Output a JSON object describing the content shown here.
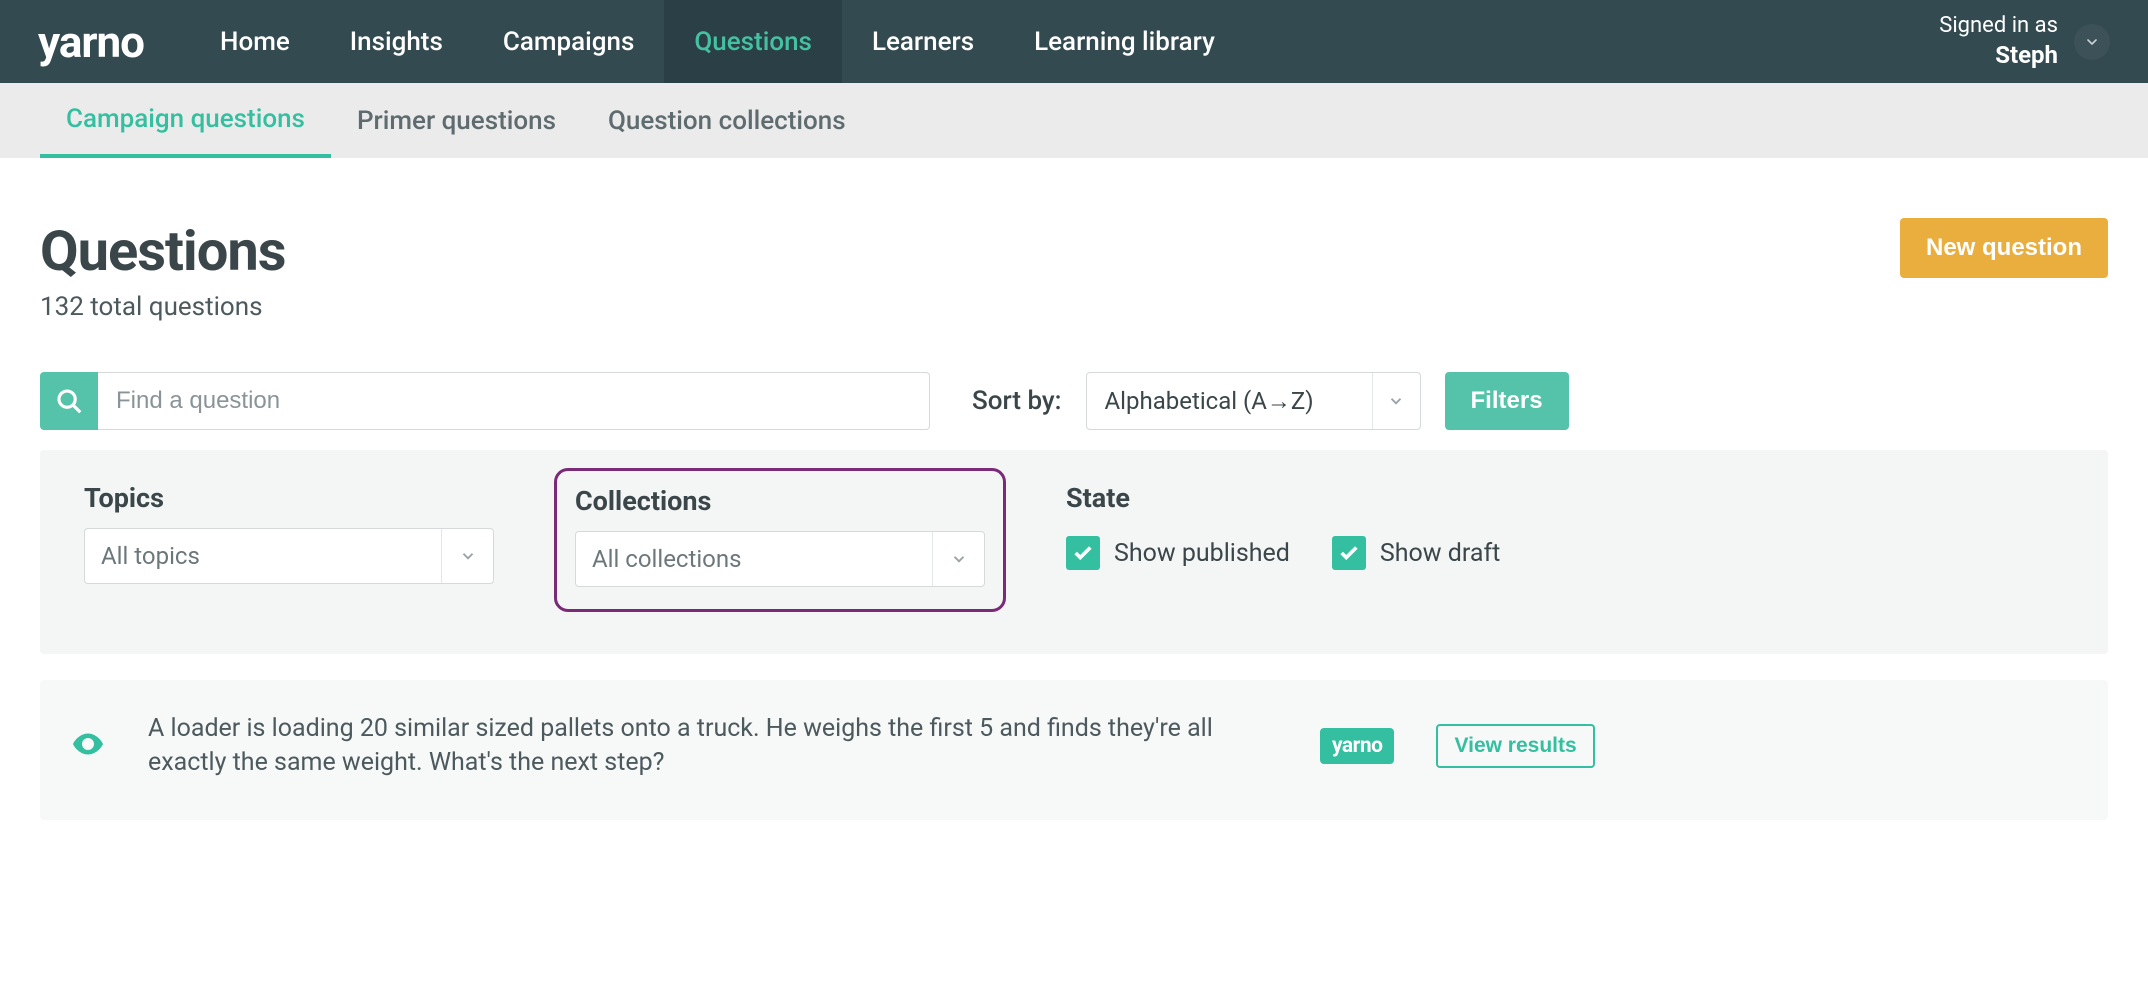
{
  "brand": "yarno",
  "nav": {
    "items": [
      {
        "label": "Home",
        "active": false
      },
      {
        "label": "Insights",
        "active": false
      },
      {
        "label": "Campaigns",
        "active": false
      },
      {
        "label": "Questions",
        "active": true
      },
      {
        "label": "Learners",
        "active": false
      },
      {
        "label": "Learning library",
        "active": false
      }
    ],
    "signed_in_prefix": "Signed in as",
    "user_name": "Steph"
  },
  "subnav": {
    "tabs": [
      {
        "label": "Campaign questions",
        "active": true
      },
      {
        "label": "Primer questions",
        "active": false
      },
      {
        "label": "Question collections",
        "active": false
      }
    ]
  },
  "page": {
    "title": "Questions",
    "subtitle": "132 total questions",
    "new_question_label": "New question"
  },
  "search": {
    "placeholder": "Find a question",
    "value": ""
  },
  "sort": {
    "label": "Sort by:",
    "selected": "Alphabetical (A→Z)"
  },
  "filters_button": "Filters",
  "filters": {
    "topics": {
      "label": "Topics",
      "selected": "All topics"
    },
    "collections": {
      "label": "Collections",
      "selected": "All collections"
    },
    "state": {
      "label": "State",
      "show_published": {
        "label": "Show published",
        "checked": true
      },
      "show_draft": {
        "label": "Show draft",
        "checked": true
      }
    }
  },
  "questions": [
    {
      "text": "A loader is loading 20 similar sized pallets onto a truck. He weighs the first 5 and finds they're all exactly the same weight. What's the next step?",
      "badge": "yarno",
      "view_results_label": "View results"
    }
  ]
}
